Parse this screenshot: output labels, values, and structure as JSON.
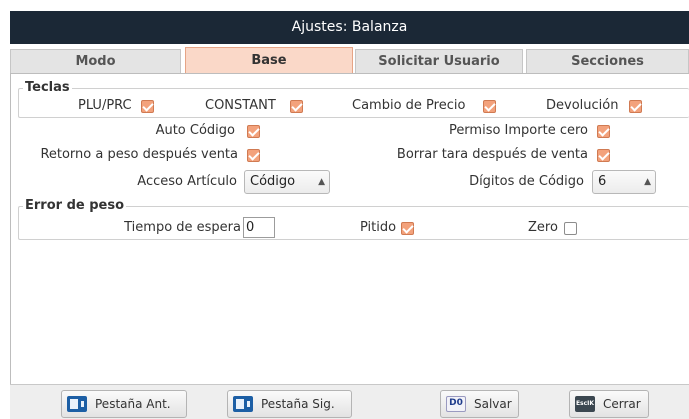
{
  "window": {
    "title": "Ajustes: Balanza"
  },
  "tabs": [
    {
      "label": "Modo",
      "active": false
    },
    {
      "label": "Base",
      "active": true
    },
    {
      "label": "Solicitar Usuario",
      "active": false
    },
    {
      "label": "Secciones",
      "active": false
    }
  ],
  "teclas": {
    "title": "Teclas",
    "plu_prc": {
      "label": "PLU/PRC",
      "checked": true
    },
    "constant": {
      "label": "CONSTANT",
      "checked": true
    },
    "cambio_precio": {
      "label": "Cambio de Precio",
      "checked": true
    },
    "devolucion": {
      "label": "Devolución",
      "checked": true
    }
  },
  "options": {
    "auto_codigo": {
      "label": "Auto Código",
      "checked": true
    },
    "permiso_importe_cero": {
      "label": "Permiso Importe cero",
      "checked": true
    },
    "retorno_peso": {
      "label": "Retorno a peso después venta",
      "checked": true
    },
    "borrar_tara": {
      "label": "Borrar tara después de venta",
      "checked": true
    },
    "acceso_articulo": {
      "label": "Acceso Artículo",
      "value": "Código"
    },
    "digitos_codigo": {
      "label": "Dígitos de Código",
      "value": "6"
    }
  },
  "error_peso": {
    "title": "Error de peso",
    "tiempo_espera": {
      "label": "Tiempo de espera",
      "value": "0"
    },
    "pitido": {
      "label": "Pitido",
      "checked": true
    },
    "zero": {
      "label": "Zero",
      "checked": false
    }
  },
  "buttons": {
    "prev_tab": {
      "label": "Pestaña Ant.",
      "icon": "tab-back-icon"
    },
    "next_tab": {
      "label": "Pestaña Sig.",
      "icon": "tab-forward-icon"
    },
    "save": {
      "label": "Salvar",
      "icon_text": "D0",
      "icon_sub": "Save"
    },
    "close": {
      "label": "Cerrar",
      "icon_text": "EscIK"
    }
  },
  "colors": {
    "titlebar": "#1b2836",
    "accent": "#f3a27c",
    "active_tab": "#fad8c8"
  }
}
